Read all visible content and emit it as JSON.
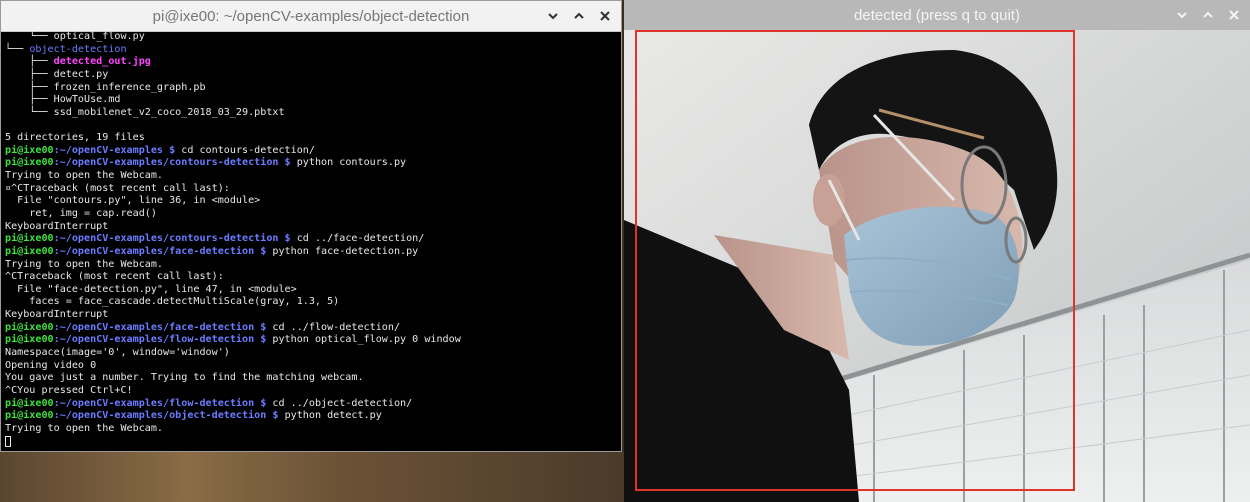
{
  "terminal": {
    "title": "pi@ixe00: ~/openCV-examples/object-detection",
    "lines": [
      [
        {
          "t": "    └── ",
          "c": "tree"
        },
        {
          "t": "optical_flow.py",
          "c": "text"
        }
      ],
      [
        {
          "t": "└── ",
          "c": "tree"
        },
        {
          "t": "object-detection",
          "c": "dir"
        }
      ],
      [
        {
          "t": "    ├── ",
          "c": "tree"
        },
        {
          "t": "detected_out.jpg",
          "c": "img"
        }
      ],
      [
        {
          "t": "    ├── ",
          "c": "tree"
        },
        {
          "t": "detect.py",
          "c": "text"
        }
      ],
      [
        {
          "t": "    ├── ",
          "c": "tree"
        },
        {
          "t": "frozen_inference_graph.pb",
          "c": "text"
        }
      ],
      [
        {
          "t": "    ├── ",
          "c": "tree"
        },
        {
          "t": "HowToUse.md",
          "c": "text"
        }
      ],
      [
        {
          "t": "    └── ",
          "c": "tree"
        },
        {
          "t": "ssd_mobilenet_v2_coco_2018_03_29.pbtxt",
          "c": "text"
        }
      ],
      [
        {
          "t": "",
          "c": "text"
        }
      ],
      [
        {
          "t": "5 directories, 19 files",
          "c": "text"
        }
      ],
      [
        {
          "t": "pi@ixe00",
          "c": "prompt"
        },
        {
          "t": ":~/openCV-examples",
          "c": "path"
        },
        {
          "t": " $ ",
          "c": "path"
        },
        {
          "t": "cd contours-detection/",
          "c": "text"
        }
      ],
      [
        {
          "t": "pi@ixe00",
          "c": "prompt"
        },
        {
          "t": ":~/openCV-examples/contours-detection",
          "c": "path"
        },
        {
          "t": " $ ",
          "c": "path"
        },
        {
          "t": "python contours.py",
          "c": "text"
        }
      ],
      [
        {
          "t": "Trying to open the Webcam.",
          "c": "text"
        }
      ],
      [
        {
          "t": "¤^CTraceback (most recent call last):",
          "c": "text"
        }
      ],
      [
        {
          "t": "  File \"contours.py\", line 36, in <module>",
          "c": "text"
        }
      ],
      [
        {
          "t": "    ret, img = cap.read()",
          "c": "text"
        }
      ],
      [
        {
          "t": "KeyboardInterrupt",
          "c": "text"
        }
      ],
      [
        {
          "t": "pi@ixe00",
          "c": "prompt"
        },
        {
          "t": ":~/openCV-examples/contours-detection",
          "c": "path"
        },
        {
          "t": " $ ",
          "c": "path"
        },
        {
          "t": "cd ../face-detection/",
          "c": "text"
        }
      ],
      [
        {
          "t": "pi@ixe00",
          "c": "prompt"
        },
        {
          "t": ":~/openCV-examples/face-detection",
          "c": "path"
        },
        {
          "t": " $ ",
          "c": "path"
        },
        {
          "t": "python face-detection.py",
          "c": "text"
        }
      ],
      [
        {
          "t": "Trying to open the Webcam.",
          "c": "text"
        }
      ],
      [
        {
          "t": "^CTraceback (most recent call last):",
          "c": "text"
        }
      ],
      [
        {
          "t": "  File \"face-detection.py\", line 47, in <module>",
          "c": "text"
        }
      ],
      [
        {
          "t": "    faces = face_cascade.detectMultiScale(gray, 1.3, 5)",
          "c": "text"
        }
      ],
      [
        {
          "t": "KeyboardInterrupt",
          "c": "text"
        }
      ],
      [
        {
          "t": "pi@ixe00",
          "c": "prompt"
        },
        {
          "t": ":~/openCV-examples/face-detection",
          "c": "path"
        },
        {
          "t": " $ ",
          "c": "path"
        },
        {
          "t": "cd ../flow-detection/",
          "c": "text"
        }
      ],
      [
        {
          "t": "pi@ixe00",
          "c": "prompt"
        },
        {
          "t": ":~/openCV-examples/flow-detection",
          "c": "path"
        },
        {
          "t": " $ ",
          "c": "path"
        },
        {
          "t": "python optical_flow.py 0 window",
          "c": "text"
        }
      ],
      [
        {
          "t": "Namespace(image='0', window='window')",
          "c": "text"
        }
      ],
      [
        {
          "t": "Opening video 0",
          "c": "text"
        }
      ],
      [
        {
          "t": "You gave just a number. Trying to find the matching webcam.",
          "c": "text"
        }
      ],
      [
        {
          "t": "^CYou pressed Ctrl+C!",
          "c": "text"
        }
      ],
      [
        {
          "t": "pi@ixe00",
          "c": "prompt"
        },
        {
          "t": ":~/openCV-examples/flow-detection",
          "c": "path"
        },
        {
          "t": " $ ",
          "c": "path"
        },
        {
          "t": "cd ../object-detection/",
          "c": "text"
        }
      ],
      [
        {
          "t": "pi@ixe00",
          "c": "prompt"
        },
        {
          "t": ":~/openCV-examples/object-detection",
          "c": "path"
        },
        {
          "t": " $ ",
          "c": "path"
        },
        {
          "t": "python detect.py",
          "c": "text"
        }
      ],
      [
        {
          "t": "Trying to open the Webcam.",
          "c": "text"
        }
      ],
      [
        {
          "t": "",
          "c": "cursor"
        }
      ]
    ]
  },
  "camera": {
    "title": "detected (press q to quit)",
    "box_color": "#e0342a"
  },
  "icons": {
    "minimize": "chevron-down-icon",
    "maximize": "chevron-up-icon",
    "close": "close-icon"
  },
  "colors": {
    "prompt": "#3de23d",
    "path": "#6b7cff",
    "image_file": "#ff45ff",
    "terminal_bg": "#000000"
  }
}
